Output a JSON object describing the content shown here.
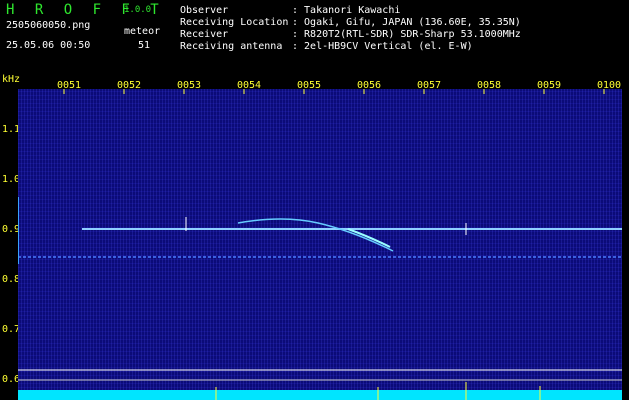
{
  "header": {
    "app_name": "H R O F F T",
    "version": "1.0.0",
    "filename": "2505060050.png",
    "meteor_label": "meteor",
    "datetime": "25.05.06 00:50",
    "meteor_count": "51",
    "observer_label": "Observer",
    "observer_value": ": Takanori Kawachi",
    "location_label": "Receiving Location",
    "location_value": ": Ogaki, Gifu, JAPAN (136.60E, 35.35N)",
    "receiver_label": "Receiver",
    "receiver_value": ": R820T2(RTL-SDR) SDR-Sharp 53.1000MHz",
    "antenna_label": "Receiving antenna",
    "antenna_value": ": 2el-HB9CV Vertical (el. E-W)"
  },
  "axis": {
    "y_unit": "kHz",
    "y_ticks": [
      "1.1",
      "1.0",
      "0.9",
      "0.8",
      "0.7",
      "0.6"
    ],
    "x_ticks": [
      "0051",
      "0052",
      "0053",
      "0054",
      "0055",
      "0056",
      "0057",
      "0058",
      "0059",
      "0100"
    ]
  },
  "colors": {
    "title_green": "#2ee62e",
    "tick_yellow": "#ffff33",
    "background_blue": "#0b0b78",
    "signal_cyan": "#66ccff",
    "baseline_cyan": "#00e5ff"
  }
}
